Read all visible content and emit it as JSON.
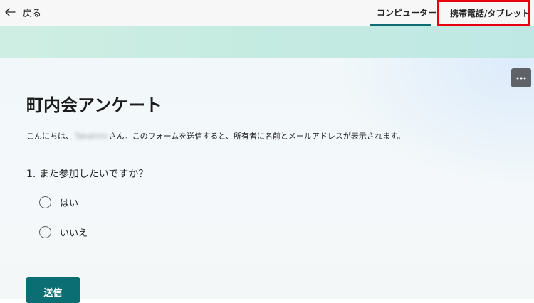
{
  "topbar": {
    "back_label": "戻る",
    "view_tabs": [
      {
        "label": "コンピューター",
        "icon": "monitor-icon",
        "selected": true
      },
      {
        "label": "携帯電話/タブレット",
        "icon": "phone-icon",
        "selected": false,
        "highlighted": true
      }
    ]
  },
  "form": {
    "more_icon": "more-options-icon",
    "title": "町内会アンケート",
    "notice_prefix": "こんにちは、",
    "user_name": "Takahiro",
    "notice_suffix": "さん。このフォームを送信すると、所有者に名前とメールアドレスが表示されます。",
    "question": "1. また参加したいですか？",
    "options": [
      "はい",
      "いいえ"
    ],
    "submit_label": "送信"
  },
  "colors": {
    "accent": "#0b6e73",
    "highlight_border": "#e60012",
    "banner": "#c7ece2",
    "more_button": "#5f6368"
  }
}
